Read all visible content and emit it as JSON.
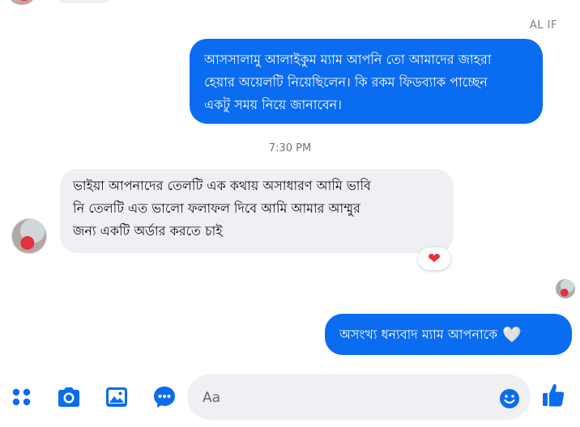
{
  "conversation": {
    "sender_name": "AL IF",
    "outgoing_message_1": {
      "lines": [
        "আসসালামু আলাইকুম ম্যাম আপনি তো আমাদের জাহরা",
        "হেয়ার অয়েলটি নিয়েছিলেন। কি রকম ফিডব্যাক পাচ্ছেন",
        "একটু সময় নিয়ে জানাবেন।"
      ]
    },
    "timestamp": "7:30 PM",
    "incoming_message": {
      "lines": [
        "ভাইয়া আপনাদের তেলটি এক কথায় অসাধারণ আমি ভাবি",
        "নি তেলটি এত ভালো ফলাফল দিবে আমি আমার আম্মুর",
        "জন্য একটি অর্ডার করতে চাই"
      ],
      "reaction": "❤"
    },
    "outgoing_message_2": {
      "text": "অসংখ্য ধন্যবাদ ম্যাম আপনাকে",
      "emoji": "🤍"
    }
  },
  "composer": {
    "placeholder": "Aa",
    "icons": [
      "menu-dots-icon",
      "camera-icon",
      "gallery-icon",
      "voice-chat-icon",
      "emoji-icon",
      "like-icon"
    ]
  },
  "colors": {
    "outgoing_bubble": "#0a6cf0",
    "incoming_bubble": "#eff0f3",
    "accent": "#0a6cf0",
    "reaction_heart": "#e8323c"
  }
}
